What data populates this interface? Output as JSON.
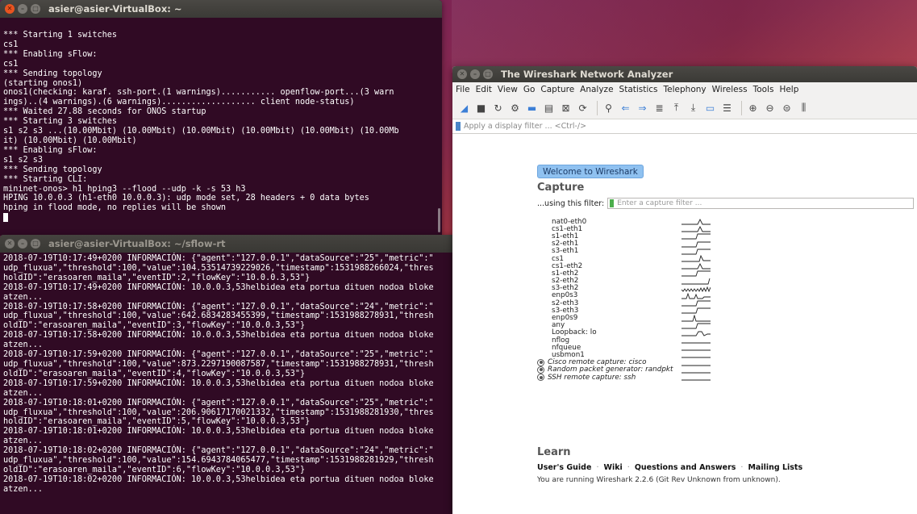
{
  "terminal1": {
    "title": "asier@asier-VirtualBox: ~",
    "lines": [
      "*** Starting 1 switches",
      "cs1",
      "*** Enabling sFlow:",
      "cs1",
      "*** Sending topology",
      "(starting onos1)",
      "onos1(checking: karaf. ssh-port.(1 warnings)........... openflow-port...(3 warn",
      "ings)..(4 warnings).(6 warnings)................... client node-status)",
      "*** Waited 27.88 seconds for ONOS startup",
      "*** Starting 3 switches",
      "s1 s2 s3 ...(10.00Mbit) (10.00Mbit) (10.00Mbit) (10.00Mbit) (10.00Mbit) (10.00Mb",
      "it) (10.00Mbit) (10.00Mbit)",
      "*** Enabling sFlow:",
      "s1 s2 s3",
      "*** Sending topology",
      "*** Starting CLI:",
      "mininet-onos> h1 hping3 --flood --udp -k -s 53 h3",
      "HPING 10.0.0.3 (h1-eth0 10.0.0.3): udp mode set, 28 headers + 0 data bytes",
      "hping in flood mode, no replies will be shown"
    ]
  },
  "terminal2": {
    "title": "asier@asier-VirtualBox: ~/sflow-rt",
    "lines": [
      "2018-07-19T10:17:49+0200 INFORMACIÓN: {\"agent\":\"127.0.0.1\",\"dataSource\":\"25\",\"metric\":\"",
      "udp_fluxua\",\"threshold\":100,\"value\":104.53514739229026,\"timestamp\":1531988266024,\"thres",
      "holdID\":\"erasoaren_maila\",\"eventID\":2,\"flowKey\":\"10.0.0.3,53\"}",
      "2018-07-19T10:17:49+0200 INFORMACIÓN: 10.0.0.3,53helbidea eta portua dituen nodoa bloke",
      "atzen...",
      "2018-07-19T10:17:58+0200 INFORMACIÓN: {\"agent\":\"127.0.0.1\",\"dataSource\":\"24\",\"metric\":\"",
      "udp_fluxua\",\"threshold\":100,\"value\":642.6834283455399,\"timestamp\":1531988278931,\"thresh",
      "oldID\":\"erasoaren_maila\",\"eventID\":3,\"flowKey\":\"10.0.0.3,53\"}",
      "2018-07-19T10:17:58+0200 INFORMACIÓN: 10.0.0.3,53helbidea eta portua dituen nodoa bloke",
      "atzen...",
      "2018-07-19T10:17:59+0200 INFORMACIÓN: {\"agent\":\"127.0.0.1\",\"dataSource\":\"25\",\"metric\":\"",
      "udp_fluxua\",\"threshold\":100,\"value\":873.2297190087587,\"timestamp\":1531988278931,\"thresh",
      "oldID\":\"erasoaren_maila\",\"eventID\":4,\"flowKey\":\"10.0.0.3,53\"}",
      "2018-07-19T10:17:59+0200 INFORMACIÓN: 10.0.0.3,53helbidea eta portua dituen nodoa bloke",
      "atzen...",
      "2018-07-19T10:18:01+0200 INFORMACIÓN: {\"agent\":\"127.0.0.1\",\"dataSource\":\"25\",\"metric\":\"",
      "udp_fluxua\",\"threshold\":100,\"value\":206.90617170021332,\"timestamp\":1531988281930,\"thres",
      "holdID\":\"erasoaren_maila\",\"eventID\":5,\"flowKey\":\"10.0.0.3,53\"}",
      "2018-07-19T10:18:01+0200 INFORMACIÓN: 10.0.0.3,53helbidea eta portua dituen nodoa bloke",
      "atzen...",
      "2018-07-19T10:18:02+0200 INFORMACIÓN: {\"agent\":\"127.0.0.1\",\"dataSource\":\"24\",\"metric\":\"",
      "udp_fluxua\",\"threshold\":100,\"value\":154.6943784065477,\"timestamp\":1531988281929,\"thresh",
      "oldID\":\"erasoaren_maila\",\"eventID\":6,\"flowKey\":\"10.0.0.3,53\"}",
      "2018-07-19T10:18:02+0200 INFORMACIÓN: 10.0.0.3,53helbidea eta portua dituen nodoa bloke",
      "atzen..."
    ]
  },
  "wireshark": {
    "title": "The Wireshark Network Analyzer",
    "menu": [
      "File",
      "Edit",
      "View",
      "Go",
      "Capture",
      "Analyze",
      "Statistics",
      "Telephony",
      "Wireless",
      "Tools",
      "Help"
    ],
    "display_filter_placeholder": "Apply a display filter ... <Ctrl-/>",
    "welcome_button": "Welcome to Wireshark",
    "capture_title": "Capture",
    "using_filter_label": "...using this filter:",
    "capture_filter_placeholder": "Enter a capture filter ...",
    "interfaces": [
      {
        "name": "nat0-eth0",
        "spark": "pulse"
      },
      {
        "name": "cs1-eth1",
        "spark": "pulse"
      },
      {
        "name": "s1-eth1",
        "spark": "step"
      },
      {
        "name": "s2-eth1",
        "spark": "step"
      },
      {
        "name": "s3-eth1",
        "spark": "step"
      },
      {
        "name": "cs1",
        "spark": "spike"
      },
      {
        "name": "cs1-eth2",
        "spark": "pulse"
      },
      {
        "name": "s1-eth2",
        "spark": "step"
      },
      {
        "name": "s2-eth2",
        "spark": "end"
      },
      {
        "name": "s3-eth2",
        "spark": "noise"
      },
      {
        "name": "enp0s3",
        "spark": "double"
      },
      {
        "name": "s2-eth3",
        "spark": "step"
      },
      {
        "name": "s3-eth3",
        "spark": "step"
      },
      {
        "name": "enp0s9",
        "spark": "mid"
      },
      {
        "name": "any",
        "spark": "step"
      },
      {
        "name": "Loopback: lo",
        "spark": "bump"
      },
      {
        "name": "nflog",
        "spark": "flat"
      },
      {
        "name": "nfqueue",
        "spark": "flat"
      },
      {
        "name": "usbmon1",
        "spark": "flat"
      }
    ],
    "remote_interfaces": [
      {
        "name": "Cisco remote capture: cisco"
      },
      {
        "name": "Random packet generator: randpkt"
      },
      {
        "name": "SSH remote capture: ssh"
      }
    ],
    "learn_title": "Learn",
    "learn_links": [
      "User's Guide",
      "Wiki",
      "Questions and Answers",
      "Mailing Lists"
    ],
    "version_text": "You are running Wireshark 2.2.6 (Git Rev Unknown from unknown)."
  },
  "colors": {
    "terminal_bg": "#300a24",
    "close_button": "#e95420",
    "welcome_button_bg": "#8fc1f0"
  },
  "icons": {
    "window_close": "✕",
    "window_min": "–",
    "window_max": "□"
  }
}
